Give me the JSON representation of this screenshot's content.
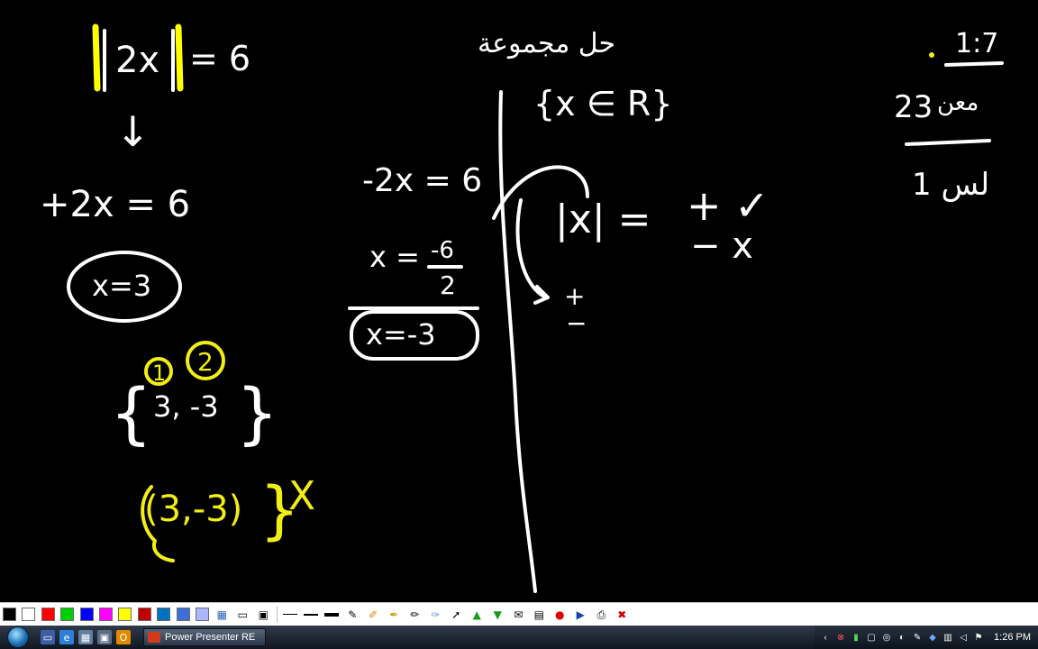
{
  "board": {
    "eq_main": "2x",
    "eq_equals_6": "= 6",
    "arrow_down": "↓",
    "case_pos": "+2x = 6",
    "sol_pos": "x=3",
    "case_neg": "-2x = 6",
    "frac_lhs": "x =",
    "frac_num": "-6",
    "frac_den": "2",
    "sol_neg": "x=-3",
    "set_brace_open": "{",
    "set_vals": "3, -3",
    "set_brace_close": "}",
    "mark_one": "1",
    "mark_two": "2",
    "tuple": "(3,-3)",
    "tuple_close": "}",
    "cross_mark": "X",
    "top_arabic": "حل مجموعة",
    "domain_set": "{x ∈ R}",
    "abs_x": "|x| =",
    "plus_check": "+ ✓",
    "minus_x": "− x",
    "plus_small": "+",
    "minus_small": "−",
    "page_num": "1:7",
    "right_num": "23",
    "right_arabic_top": "معن",
    "right_arabic_bottom": "1 لس"
  },
  "toolbar": {
    "swatches": [
      "#000000",
      "#ffffff",
      "#ff0000",
      "#00d000",
      "#0000ff",
      "#ff00ff",
      "#ffff00",
      "#c00000",
      "#0070c0",
      "#3d6fd8",
      "#a9b7ff"
    ],
    "tools": [
      "color-picker-icon",
      "screen-icon",
      "whiteboard-icon",
      "blackboard-icon",
      "thin-line-icon",
      "medium-line-icon",
      "thick-line-icon",
      "pen-icon",
      "eraser-icon",
      "marker-icon",
      "brush-icon",
      "highlighter-icon",
      "pointer-icon",
      "arrow-up-icon",
      "arrow-down-icon",
      "envelope-icon",
      "save-icon",
      "record-icon",
      "play-icon",
      "print-icon",
      "exit-icon"
    ]
  },
  "taskbar": {
    "task_label": "Power Presenter RE",
    "clock": "1:26 PM"
  }
}
